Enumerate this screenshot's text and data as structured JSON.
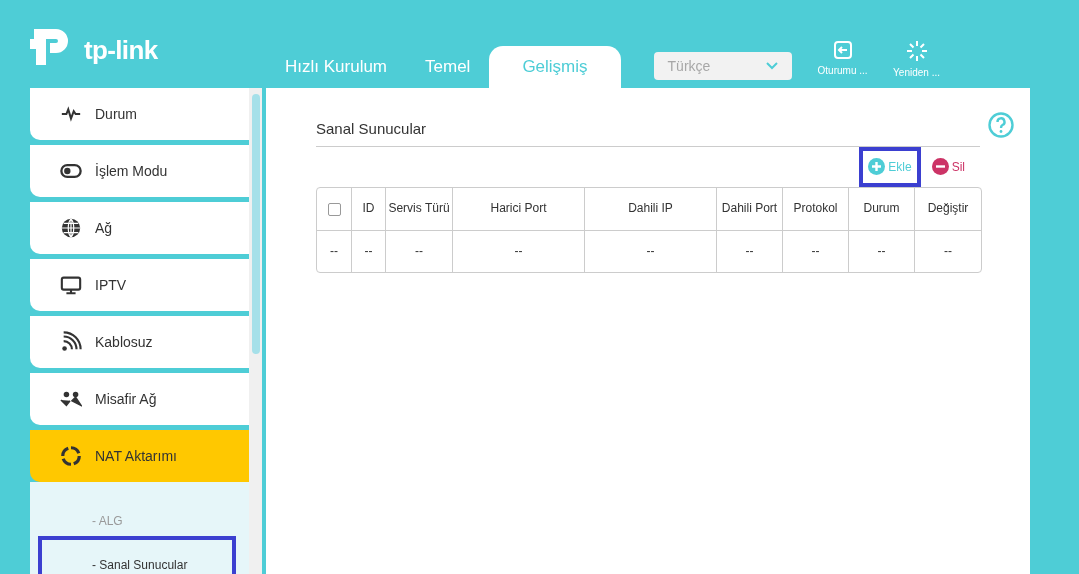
{
  "logo": {
    "text": "tp-link"
  },
  "tabs": [
    {
      "label": "Hızlı Kurulum",
      "selected": false
    },
    {
      "label": "Temel",
      "selected": false
    },
    {
      "label": "Gelişmiş",
      "selected": true
    }
  ],
  "language": {
    "value": "Türkçe"
  },
  "header_actions": [
    {
      "label": "Oturumu ..."
    },
    {
      "label": "Yeniden ..."
    }
  ],
  "sidebar": {
    "items": [
      {
        "label": "Durum",
        "selected": false
      },
      {
        "label": "İşlem Modu",
        "selected": false
      },
      {
        "label": "Ağ",
        "selected": false
      },
      {
        "label": "IPTV",
        "selected": false
      },
      {
        "label": "Kablosuz",
        "selected": false
      },
      {
        "label": "Misafir Ağ",
        "selected": false
      },
      {
        "label": "NAT Aktarımı",
        "selected": true,
        "expanded": true,
        "children": [
          {
            "label": "- ALG",
            "selected": false,
            "highlighted": false
          },
          {
            "label": "- Sanal Sunucular",
            "selected": true,
            "highlighted": true
          }
        ]
      }
    ]
  },
  "section": {
    "title": "Sanal Sunucular"
  },
  "actions": [
    {
      "label": "Ekle",
      "kind": "add",
      "highlighted": true
    },
    {
      "label": "Sil",
      "kind": "delete",
      "highlighted": false
    }
  ],
  "table": {
    "select_all_checked": false,
    "columns": [
      "ID",
      "Servis Türü",
      "Harici Port",
      "Dahili IP",
      "Dahili Port",
      "Protokol",
      "Durum",
      "Değiştir"
    ],
    "rows": [
      {
        "checkbox_text": "--",
        "cells": [
          "--",
          "--",
          "--",
          "--",
          "--",
          "--",
          "--",
          "--"
        ]
      }
    ]
  }
}
